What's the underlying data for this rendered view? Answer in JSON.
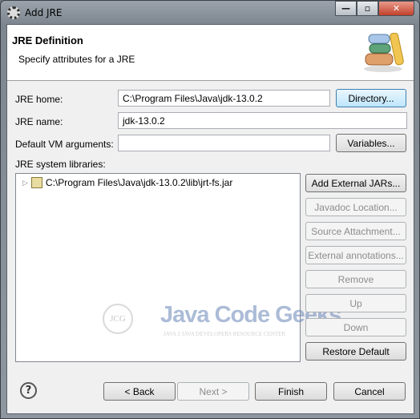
{
  "window": {
    "title": "Add JRE"
  },
  "header": {
    "title": "JRE Definition",
    "subtitle": "Specify attributes for a JRE"
  },
  "form": {
    "jre_home_label": "JRE home:",
    "jre_home_value": "C:\\Program Files\\Java\\jdk-13.0.2",
    "directory_button": "Directory...",
    "jre_name_label": "JRE name:",
    "jre_name_value": "jdk-13.0.2",
    "vm_args_label": "Default VM arguments:",
    "vm_args_value": "",
    "variables_button": "Variables...",
    "libraries_label": "JRE system libraries:"
  },
  "libraries": [
    {
      "path": "C:\\Program Files\\Java\\jdk-13.0.2\\lib\\jrt-fs.jar"
    }
  ],
  "library_buttons": [
    {
      "label": "Add External JARs...",
      "enabled": true
    },
    {
      "label": "Javadoc Location...",
      "enabled": false
    },
    {
      "label": "Source Attachment...",
      "enabled": false
    },
    {
      "label": "External annotations...",
      "enabled": false
    },
    {
      "label": "Remove",
      "enabled": false
    },
    {
      "label": "Up",
      "enabled": false
    },
    {
      "label": "Down",
      "enabled": false
    },
    {
      "label": "Restore Default",
      "enabled": true
    }
  ],
  "watermark": {
    "logo": "JCG",
    "name": "Java Code Geeks",
    "tagline": "JAVA 2 JAVA DEVELOPERS RESOURCE CENTER"
  },
  "footer": {
    "help": "?",
    "back": "< Back",
    "next": "Next >",
    "finish": "Finish",
    "cancel": "Cancel"
  }
}
